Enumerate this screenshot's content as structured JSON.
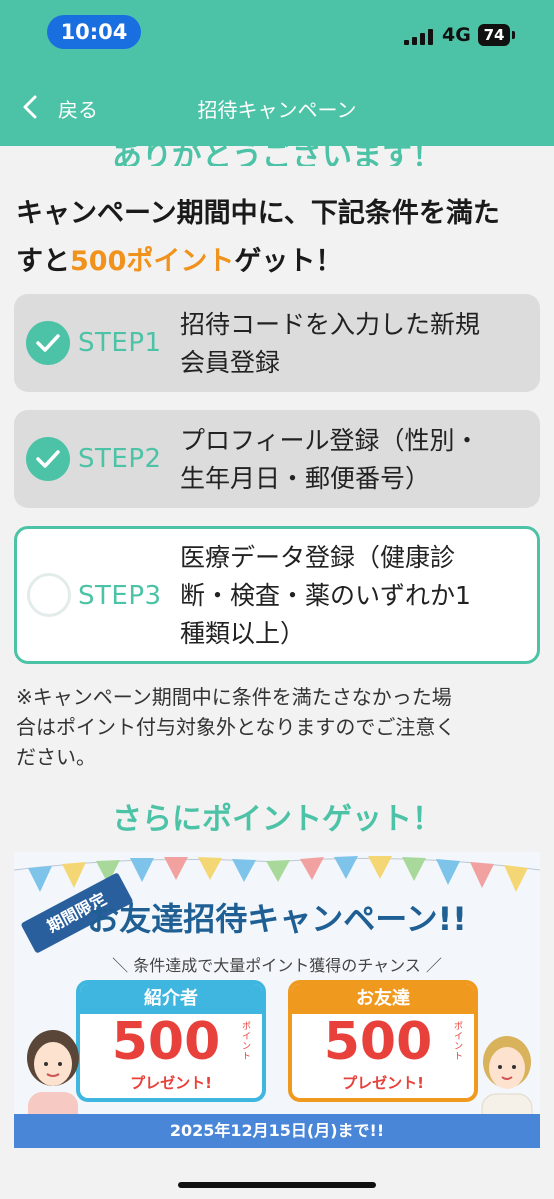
{
  "status_bar": {
    "time": "10:04",
    "network": "4G",
    "battery": "74"
  },
  "nav": {
    "back_label": "戻る",
    "title": "招待キャンペーン"
  },
  "thanks_text": "ありがとうございます！",
  "intro": {
    "line1": "キャンペーン期間中に、下記条件を満た",
    "line2_pre": "すと",
    "line2_highlight": "500ポイント",
    "line2_post": "ゲット！"
  },
  "steps": [
    {
      "label": "STEP1",
      "lines": [
        "招待コードを入力した新規",
        "会員登録"
      ],
      "completed": true
    },
    {
      "label": "STEP2",
      "lines": [
        "プロフィール登録（性別・",
        "生年月日・郵便番号）"
      ],
      "completed": true
    },
    {
      "label": "STEP3",
      "lines": [
        "医療データ登録（健康診",
        "断・検査・薬のいずれか1",
        "種類以上）"
      ],
      "completed": false
    }
  ],
  "notice": [
    "※キャンペーン期間中に条件を満たさなかった場",
    "合はポイント付与対象外となりますのでご注意く",
    "ださい。"
  ],
  "more_points": "さらにポイントゲット！",
  "banner": {
    "tag": "期間限定",
    "title": "お友達招待キャンペーン!!",
    "subtitle": "＼ 条件達成で大量ポイント獲得のチャンス ／",
    "cards": [
      {
        "head": "紹介者",
        "amount": "500",
        "unit": "ポイント",
        "present": "プレゼント!"
      },
      {
        "head": "お友達",
        "amount": "500",
        "unit": "ポイント",
        "present": "プレゼント!"
      }
    ],
    "date_text": "2025年12月15日(月)まで!!"
  },
  "colors": {
    "accent": "#4cc3a6",
    "highlight": "#f0921b",
    "status_blue": "#1a6fe0"
  }
}
